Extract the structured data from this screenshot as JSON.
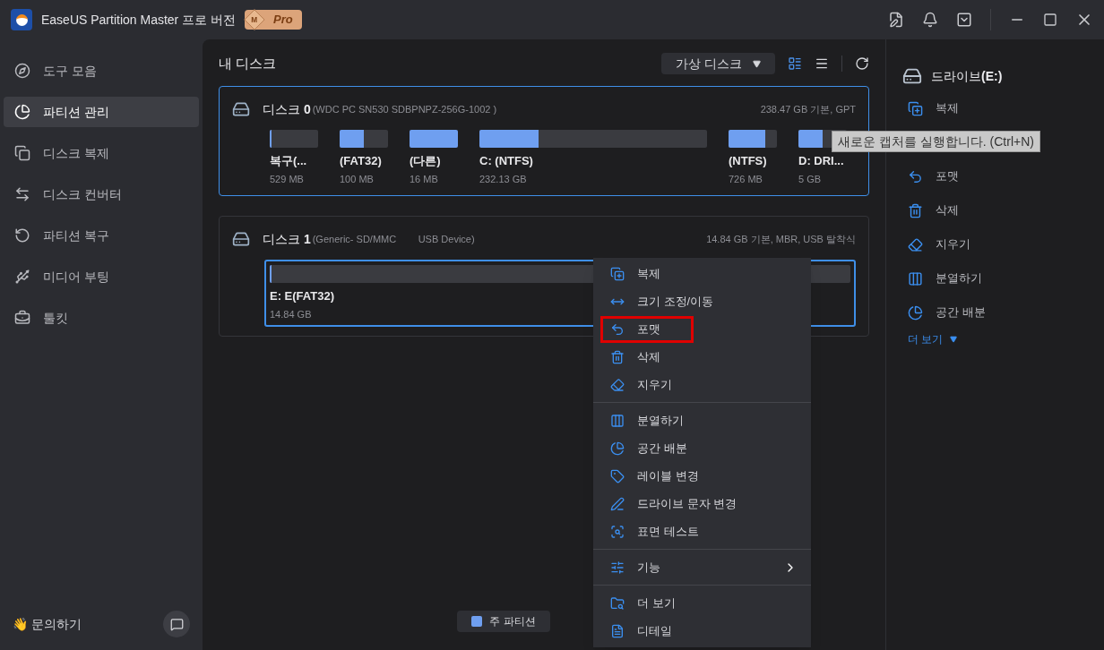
{
  "titlebar": {
    "app_name": "EaseUS Partition Master 프로 버전",
    "badge_letter": "M",
    "badge": "Pro"
  },
  "sidebar": {
    "items": [
      {
        "label": "도구 모음",
        "selected": false
      },
      {
        "label": "파티션 관리",
        "selected": true
      },
      {
        "label": "디스크 복제",
        "selected": false
      },
      {
        "label": "디스크 컨버터",
        "selected": false
      },
      {
        "label": "파티션 복구",
        "selected": false
      },
      {
        "label": "미디어 부팅",
        "selected": false
      },
      {
        "label": "툴킷",
        "selected": false
      }
    ],
    "contact": "👋 문의하기"
  },
  "main": {
    "title": "내 디스크",
    "virtual_disk": "가상 디스크",
    "disks": [
      {
        "name": "디스크",
        "number": "0",
        "model": "(WDC PC SN530 SDBPNPZ-256G-1002 )",
        "info": "238.47 GB 기본, GPT",
        "selected": true,
        "partitions": [
          {
            "label": "복구(...",
            "size": "529 MB",
            "level": 0.04,
            "kind": "small"
          },
          {
            "label": "(FAT32)",
            "size": "100 MB",
            "level": 0.5,
            "kind": "small"
          },
          {
            "label": "(다른)",
            "size": "16 MB",
            "level": 1,
            "kind": "small"
          },
          {
            "label": "C: (NTFS)",
            "size": "232.13 GB",
            "level": 0.26,
            "kind": "large"
          },
          {
            "label": "(NTFS)",
            "size": "726 MB",
            "level": 0.75,
            "kind": "small"
          },
          {
            "label": "D: DRI...",
            "size": "5 GB",
            "level": 0.5,
            "kind": "small"
          }
        ]
      },
      {
        "name": "디스크",
        "number": "1",
        "model": "(Generic- SD/MMC        USB Device)",
        "info": "14.84 GB 기본, MBR, USB 탈착식",
        "selected": false,
        "partitions": [
          {
            "label": "E: E(FAT32)",
            "size": "14.84 GB",
            "level": 0.003,
            "kind": "large",
            "selected": true
          }
        ]
      }
    ],
    "legend": [
      {
        "label": "주 파티션",
        "color": "#6f9ff0"
      }
    ]
  },
  "context_menu": {
    "groups": [
      {
        "items": [
          {
            "label": "복제",
            "highlighted": false,
            "submenu": false
          },
          {
            "label": "크기 조정/이동",
            "highlighted": false,
            "submenu": false
          },
          {
            "label": "포맷",
            "highlighted": true,
            "submenu": false
          },
          {
            "label": "삭제",
            "highlighted": false,
            "submenu": false
          },
          {
            "label": "지우기",
            "highlighted": false,
            "submenu": false
          }
        ]
      },
      {
        "items": [
          {
            "label": "분열하기",
            "highlighted": false,
            "submenu": false
          },
          {
            "label": "공간 배분",
            "highlighted": false,
            "submenu": false
          },
          {
            "label": "레이블 변경",
            "highlighted": false,
            "submenu": false
          },
          {
            "label": "드라이브 문자 변경",
            "highlighted": false,
            "submenu": false
          },
          {
            "label": "표면 테스트",
            "highlighted": false,
            "submenu": false
          }
        ]
      },
      {
        "items": [
          {
            "label": "기능",
            "highlighted": false,
            "submenu": true
          }
        ]
      },
      {
        "items": [
          {
            "label": "더 보기",
            "highlighted": false,
            "submenu": false
          },
          {
            "label": "디테일",
            "highlighted": false,
            "submenu": false
          }
        ]
      }
    ]
  },
  "right_panel": {
    "drive": "드라이브",
    "drive_letter": "(E:)",
    "actions": [
      {
        "label": "복제"
      },
      {
        "label": "포맷"
      },
      {
        "label": "삭제"
      },
      {
        "label": "지우기"
      },
      {
        "label": "분열하기"
      },
      {
        "label": "공간 배분"
      }
    ],
    "more": "더 보기"
  },
  "tooltip": "새로운 캡처를 실행합니다. (Ctrl+N)"
}
